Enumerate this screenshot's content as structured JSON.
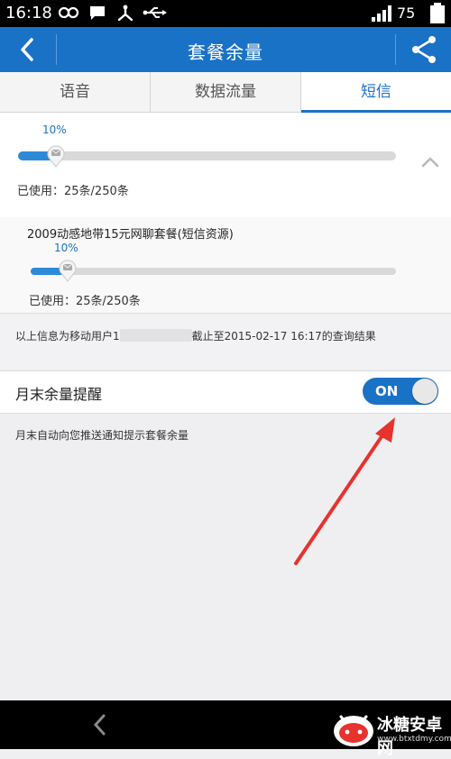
{
  "status_bar": {
    "time": "16:18",
    "battery": "75",
    "icons": [
      "infinity-icon",
      "message-icon",
      "usb-icon",
      "usb-debug-icon",
      "signal-icon",
      "battery-icon"
    ]
  },
  "header": {
    "title": "套餐余量",
    "back_icon": "chevron-left-icon",
    "share_icon": "share-icon"
  },
  "tabs": [
    {
      "label": "语音",
      "active": false
    },
    {
      "label": "数据流量",
      "active": false
    },
    {
      "label": "短信",
      "active": true
    }
  ],
  "summary": {
    "percent_label": "10%",
    "progress": 0.1,
    "used_text": "已使用：25条/250条",
    "collapse_icon": "chevron-up-icon"
  },
  "package": {
    "name": "2009动感地带15元网聊套餐(短信资源)",
    "percent_label": "10%",
    "progress": 0.1,
    "used_text": "已使用：25条/250条"
  },
  "info": {
    "prefix": "以上信息为移动用户1",
    "suffix": "截止至2015-02-17 16:17的查询结果"
  },
  "reminder": {
    "label": "月末余量提醒",
    "toggle_text": "ON",
    "enabled": true
  },
  "description": "月末自动向您推送通知提示套餐余量",
  "watermark": {
    "title": "冰糖安卓网",
    "url": "www.btxtdmy.com"
  },
  "colors": {
    "primary": "#1a72c6",
    "fill": "#2d8ad8",
    "annotation_arrow": "#e8322e"
  }
}
